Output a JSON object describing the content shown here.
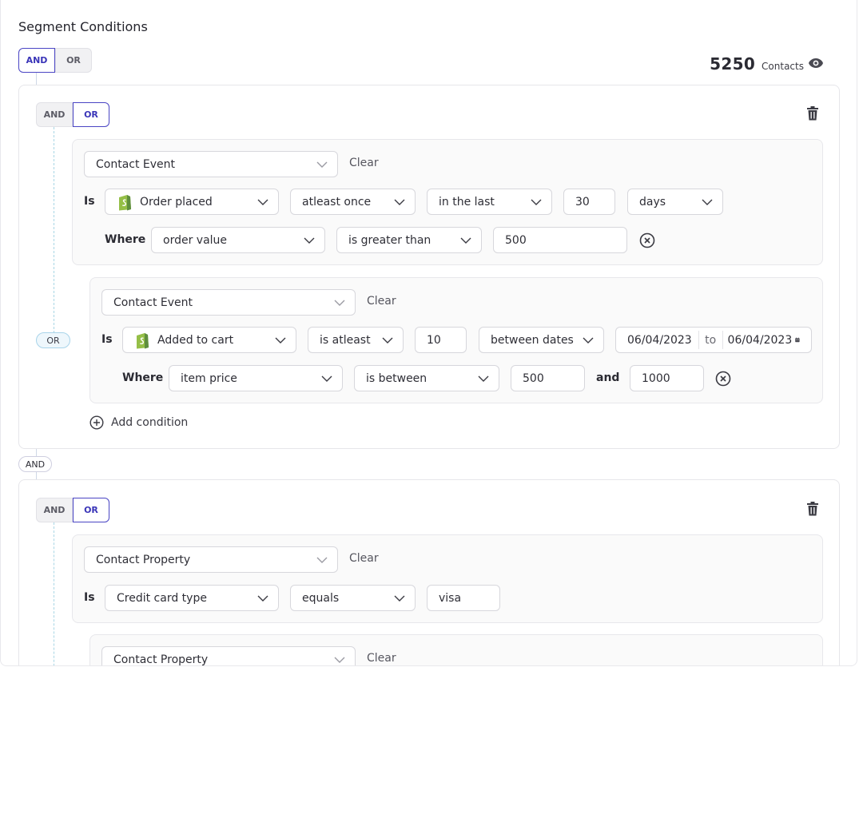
{
  "title": "Segment Conditions",
  "root_toggle": {
    "and": "AND",
    "or": "OR",
    "active": "AND"
  },
  "contacts": {
    "count": "5250",
    "label": "Contacts",
    "icon": "eye-icon"
  },
  "groups": [
    {
      "toggle": {
        "and": "AND",
        "or": "OR",
        "active": "OR"
      },
      "conditions": [
        {
          "type": "Contact Event",
          "clear": "Clear",
          "is_label": "Is",
          "event": "Order placed",
          "frequency": "atleast once",
          "time_op": "in the last",
          "amount": "30",
          "unit": "days",
          "where_label": "Where",
          "filter_field": "order value",
          "filter_op": "is greater than",
          "filter_value": "500"
        },
        {
          "type": "Contact Event",
          "clear": "Clear",
          "is_label": "Is",
          "event": "Added to cart",
          "frequency": "is atleast",
          "amount": "10",
          "time_op": "between dates",
          "date_from": "06/04/2023",
          "date_to_label": "to",
          "date_to": "06/04/2023",
          "where_label": "Where",
          "filter_field": "item price",
          "filter_op": "is between",
          "filter_value_from": "500",
          "filter_and": "and",
          "filter_value_to": "1000"
        }
      ],
      "connector": "OR",
      "add_condition": "Add condition"
    },
    {
      "toggle": {
        "and": "AND",
        "or": "OR",
        "active": "OR"
      },
      "conditions": [
        {
          "type": "Contact Property",
          "clear": "Clear",
          "is_label": "Is",
          "property": "Credit card type",
          "operator": "equals",
          "value": "visa"
        },
        {
          "type": "Contact Property",
          "clear": "Clear"
        }
      ]
    }
  ],
  "group_connector": "AND",
  "colors": {
    "accent": "#4a45c4",
    "dashed_line": "#a9d6e5",
    "shopify_green": "#95bf47"
  }
}
